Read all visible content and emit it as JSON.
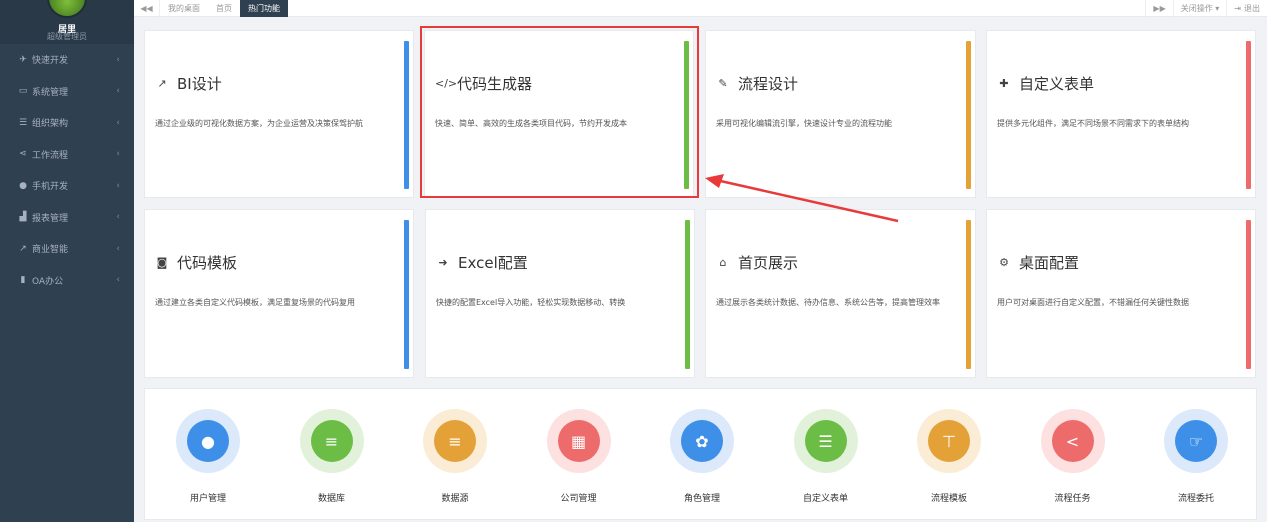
{
  "sidebar": {
    "user_name": "居里",
    "user_role": "超级管理员",
    "items": [
      {
        "icon": "paper-plane-icon",
        "glyph": "✈",
        "label": "快速开发"
      },
      {
        "icon": "desktop-icon",
        "glyph": "▭",
        "label": "系统管理"
      },
      {
        "icon": "org-icon",
        "glyph": "☰",
        "label": "组织架构"
      },
      {
        "icon": "share-icon",
        "glyph": "⋖",
        "label": "工作流程"
      },
      {
        "icon": "android-icon",
        "glyph": "●",
        "label": "手机开发"
      },
      {
        "icon": "area-chart-icon",
        "glyph": "▟",
        "label": "报表管理"
      },
      {
        "icon": "line-chart-icon",
        "glyph": "↗",
        "label": "商业智能"
      },
      {
        "icon": "bookmark-icon",
        "glyph": "▮",
        "label": "OA办公"
      }
    ]
  },
  "topbar": {
    "back": "◀◀",
    "tabs": [
      "我的桌面",
      "首页",
      "热门功能"
    ],
    "forward": "▶▶",
    "close_ops": "关闭操作 ▾",
    "logout": "退出",
    "logout_glyph": "⇥"
  },
  "cards": [
    {
      "title": "BI设计",
      "glyph": "↗",
      "icon": "line-chart-icon",
      "desc": "通过企业级的可视化数据方案，为企业运营及决策保驾护航",
      "color": "#3d8fe8"
    },
    {
      "title": "代码生成器",
      "glyph": "</>",
      "icon": "code-icon",
      "desc": "快速、简单、高效的生成各类项目代码，节约开发成本",
      "color": "#6cbd45"
    },
    {
      "title": "流程设计",
      "glyph": "✎",
      "icon": "edit-icon",
      "desc": "采用可视化编辑流引擎，快速设计专业的流程功能",
      "color": "#e4a137"
    },
    {
      "title": "自定义表单",
      "glyph": "✚",
      "icon": "puzzle-icon",
      "desc": "提供多元化组件，满足不同场景不同需求下的表单结构",
      "color": "#ee6b6b"
    },
    {
      "title": "代码模板",
      "glyph": "◙",
      "icon": "template-icon",
      "desc": "通过建立各类自定义代码模板，满足重复场景的代码复用",
      "color": "#3d8fe8"
    },
    {
      "title": "Excel配置",
      "glyph": "➜",
      "icon": "sign-in-icon",
      "desc": "快捷的配置Excel导入功能，轻松实现数据移动、转换",
      "color": "#6cbd45"
    },
    {
      "title": "首页展示",
      "glyph": "⌂",
      "icon": "home-icon",
      "desc": "通过展示各类统计数据、待办信息、系统公告等，提高管理效率",
      "color": "#e4a137"
    },
    {
      "title": "桌面配置",
      "glyph": "⚙",
      "icon": "cogs-icon",
      "desc": "用户可对桌面进行自定义配置，不错漏任何关键性数据",
      "color": "#ee6b6b"
    }
  ],
  "shortcuts": [
    {
      "label": "用户管理",
      "glyph": "●",
      "icon": "user-icon",
      "color": "#3d8fe8",
      "ring": "#dbe9fb"
    },
    {
      "label": "数据库",
      "glyph": "≡",
      "icon": "database-icon",
      "color": "#6cbd45",
      "ring": "#e2f2da"
    },
    {
      "label": "数据源",
      "glyph": "≡",
      "icon": "datasource-icon",
      "color": "#e4a137",
      "ring": "#fbecd5"
    },
    {
      "label": "公司管理",
      "glyph": "▦",
      "icon": "building-icon",
      "color": "#ee6b6b",
      "ring": "#fde0e0"
    },
    {
      "label": "角色管理",
      "glyph": "✿",
      "icon": "paw-icon",
      "color": "#3d8fe8",
      "ring": "#dbe9fb"
    },
    {
      "label": "自定义表单",
      "glyph": "☰",
      "icon": "list-icon",
      "color": "#6cbd45",
      "ring": "#e2f2da"
    },
    {
      "label": "流程模板",
      "glyph": "⊤",
      "icon": "sitemap-icon",
      "color": "#e4a137",
      "ring": "#fbecd5"
    },
    {
      "label": "流程任务",
      "glyph": "<",
      "icon": "share-alt-icon",
      "color": "#ee6b6b",
      "ring": "#fde0e0"
    },
    {
      "label": "流程委托",
      "glyph": "☞",
      "icon": "handshake-icon",
      "color": "#3d8fe8",
      "ring": "#dbe9fb"
    }
  ]
}
